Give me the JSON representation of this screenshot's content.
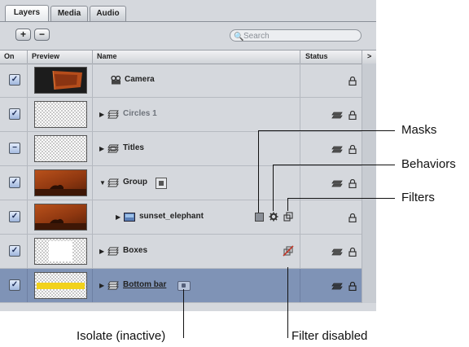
{
  "tabs": [
    {
      "label": "Layers",
      "active": true
    },
    {
      "label": "Media",
      "active": false
    },
    {
      "label": "Audio",
      "active": false
    }
  ],
  "toolbar": {
    "add_label": "+",
    "remove_label": "−",
    "search_placeholder": "Search"
  },
  "columns": {
    "on": "On",
    "preview": "Preview",
    "name": "Name",
    "status": "Status",
    "more": ">"
  },
  "rows": [
    {
      "name": "Camera",
      "on": "checked",
      "preview": "camera",
      "icon": "camera-icon",
      "disclosure": "",
      "style": "normal"
    },
    {
      "name": "Circles 1",
      "on": "checked",
      "preview": "transparent",
      "icon": "group-icon",
      "disclosure": "▶",
      "style": "dim"
    },
    {
      "name": "Titles",
      "on": "mixed",
      "preview": "transparent",
      "icon": "titles-group-icon",
      "disclosure": "▶",
      "style": "normal"
    },
    {
      "name": "Group",
      "on": "checked",
      "preview": "orange",
      "icon": "group-icon",
      "disclosure": "▼",
      "style": "normal"
    },
    {
      "name": "sunset_elephant",
      "on": "checked",
      "preview": "orange",
      "icon": "image-icon",
      "disclosure": "▶",
      "style": "normal"
    },
    {
      "name": "Boxes",
      "on": "checked",
      "preview": "white-box",
      "icon": "group-icon",
      "disclosure": "▶",
      "style": "normal"
    },
    {
      "name": "Bottom bar",
      "on": "checked",
      "preview": "yellow-bar",
      "icon": "group-icon",
      "disclosure": "▶",
      "style": "underlined",
      "selected": true
    }
  ],
  "callouts": {
    "masks": "Masks",
    "behaviors": "Behaviors",
    "filters": "Filters",
    "isolate": "Isolate (inactive)",
    "filter_disabled": "Filter disabled"
  },
  "colors": {
    "panel": "#d5d8dd",
    "selected_row": "#7f93b6",
    "checkbox": "#9fb6dc"
  }
}
